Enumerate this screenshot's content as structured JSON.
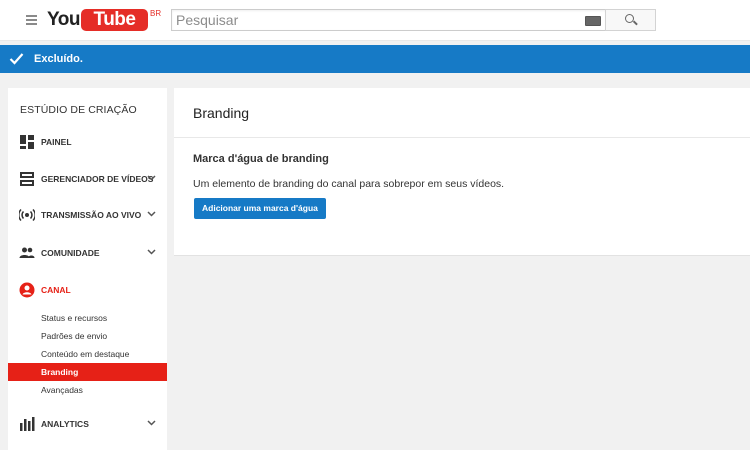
{
  "header": {
    "logo_you": "You",
    "logo_tube": "Tube",
    "logo_country": "BR",
    "search_placeholder": "Pesquisar",
    "icons": [
      "menu-icon",
      "keyboard-icon",
      "search-icon"
    ]
  },
  "notice": {
    "text": "Excluído.",
    "color": "#167ac6"
  },
  "sidebar": {
    "title": "ESTÚDIO DE CRIAÇÃO",
    "items": [
      {
        "label": "PAINEL",
        "icon": "dashboard-icon",
        "expandable": false
      },
      {
        "label": "GERENCIADOR DE VÍDEOS",
        "icon": "video-manager-icon",
        "expandable": true
      },
      {
        "label": "TRANSMISSÃO AO VIVO",
        "icon": "live-broadcast-icon",
        "expandable": true
      },
      {
        "label": "COMUNIDADE",
        "icon": "community-icon",
        "expandable": true
      },
      {
        "label": "CANAL",
        "icon": "channel-icon",
        "expandable": false,
        "active": true
      },
      {
        "label": "ANALYTICS",
        "icon": "analytics-icon",
        "expandable": true
      }
    ],
    "channel_subitems": [
      {
        "label": "Status e recursos"
      },
      {
        "label": "Padrões de envio"
      },
      {
        "label": "Conteúdo em destaque"
      },
      {
        "label": "Branding",
        "selected": true
      },
      {
        "label": "Avançadas"
      }
    ],
    "active_color": "#e62117"
  },
  "main": {
    "title": "Branding",
    "section_title": "Marca d'água de branding",
    "section_desc": "Um elemento de branding do canal para sobrepor em seus vídeos.",
    "button_label": "Adicionar uma marca d'água"
  }
}
